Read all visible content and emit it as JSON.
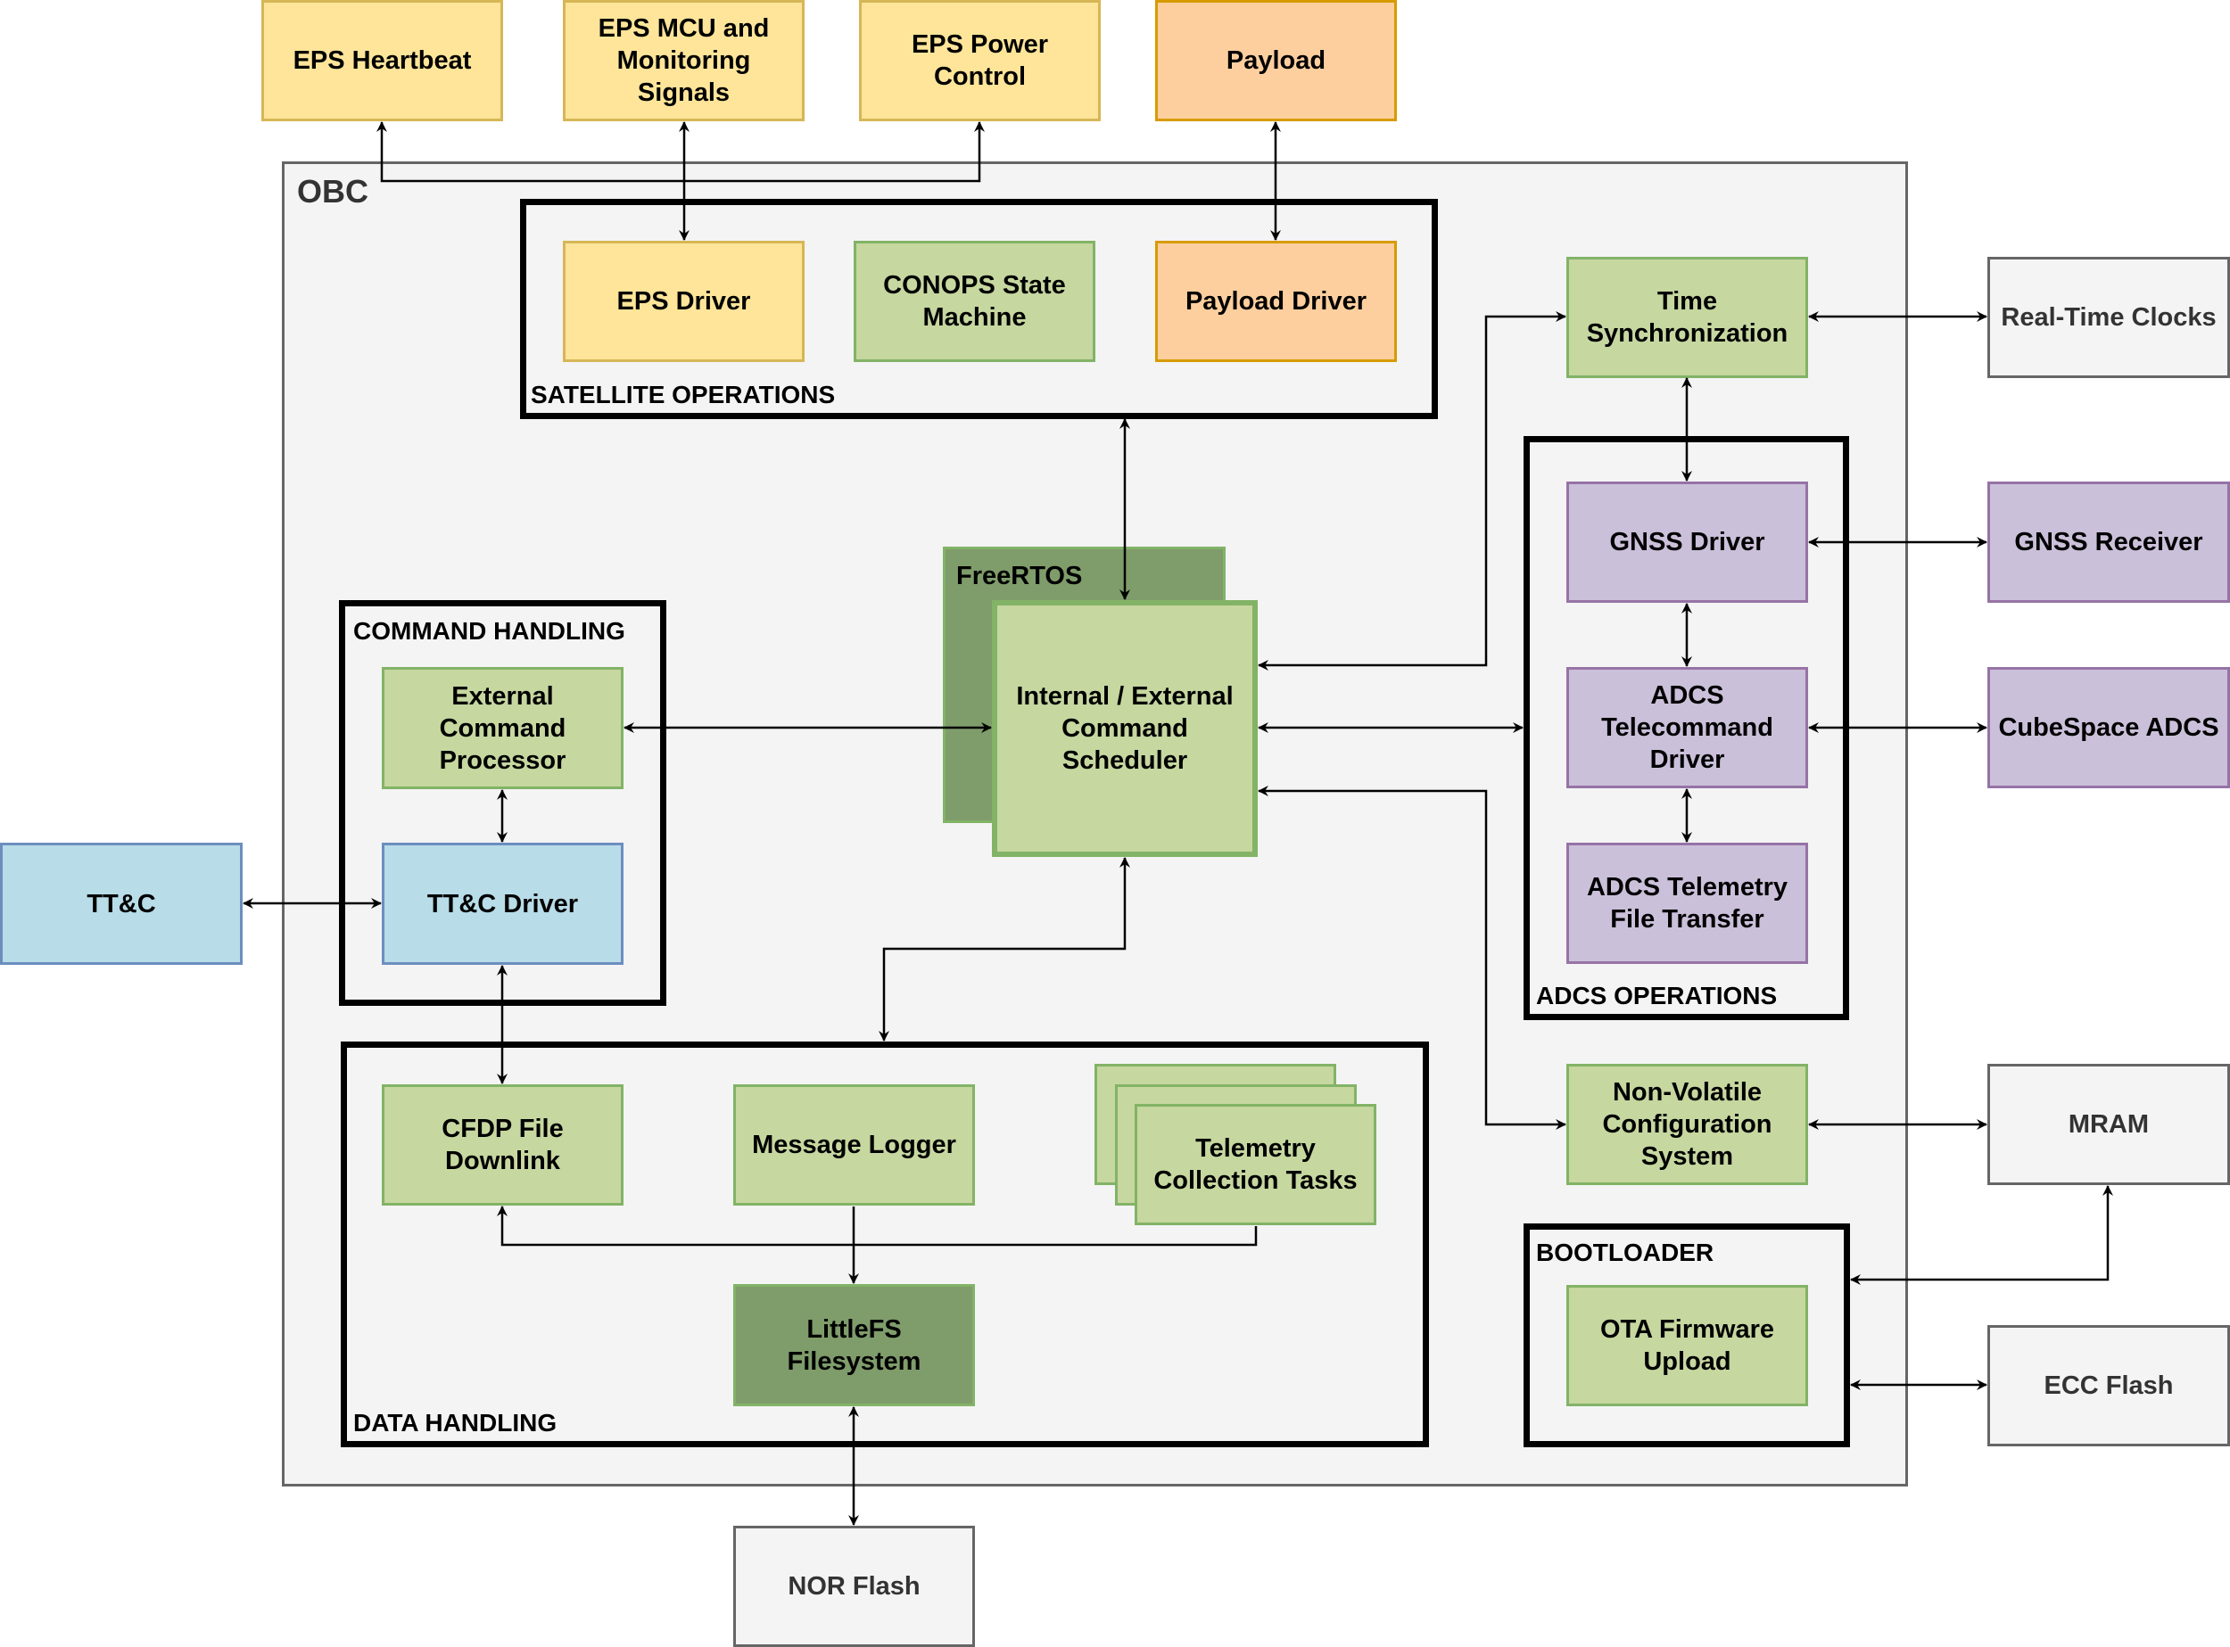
{
  "diagram": {
    "obc_label": "OBC",
    "external": {
      "eps_heartbeat": "EPS Heartbeat",
      "eps_mcu": "EPS MCU and Monitoring Signals",
      "eps_power": "EPS Power Control",
      "payload": "Payload",
      "tt_c": "TT&C",
      "real_time_clocks": "Real-Time Clocks",
      "gnss_receiver": "GNSS Receiver",
      "cubespace_adcs": "CubeSpace ADCS",
      "mram": "MRAM",
      "ecc_flash": "ECC Flash",
      "nor_flash": "NOR Flash"
    },
    "groups": {
      "satellite_operations": {
        "label": "SATELLITE OPERATIONS",
        "eps_driver": "EPS Driver",
        "conops": "CONOPS State Machine",
        "payload_driver": "Payload Driver"
      },
      "command_handling": {
        "label": "COMMAND HANDLING",
        "ext_cmd_processor": "External Command Processor",
        "ttc_driver": "TT&C Driver"
      },
      "data_handling": {
        "label": "DATA HANDLING",
        "cfdp": "CFDP File Downlink",
        "message_logger": "Message Logger",
        "telemetry_tasks": "Telemetry Collection Tasks",
        "littlefs": "LittleFS Filesystem"
      },
      "adcs_operations": {
        "label": "ADCS OPERATIONS",
        "gnss_driver": "GNSS Driver",
        "adcs_tc_driver": "ADCS Telecommand Driver",
        "adcs_telemetry": "ADCS Telemetry File Transfer"
      },
      "bootloader": {
        "label": "BOOTLOADER",
        "ota": "OTA Firmware Upload"
      }
    },
    "core": {
      "freertos": "FreeRTOS",
      "scheduler": "Internal / External Command Scheduler"
    },
    "services": {
      "time_sync": "Time Synchronization",
      "nvcs": "Non-Volatile Configuration System"
    },
    "colors": {
      "eps": "#fee599",
      "payload": "#fdcf9f",
      "software": "#c6d7a0",
      "rtos": "#7f9c6b",
      "adcs": "#cbc0da",
      "comms": "#b8dce8",
      "hardware": "#f4f4f4"
    }
  }
}
